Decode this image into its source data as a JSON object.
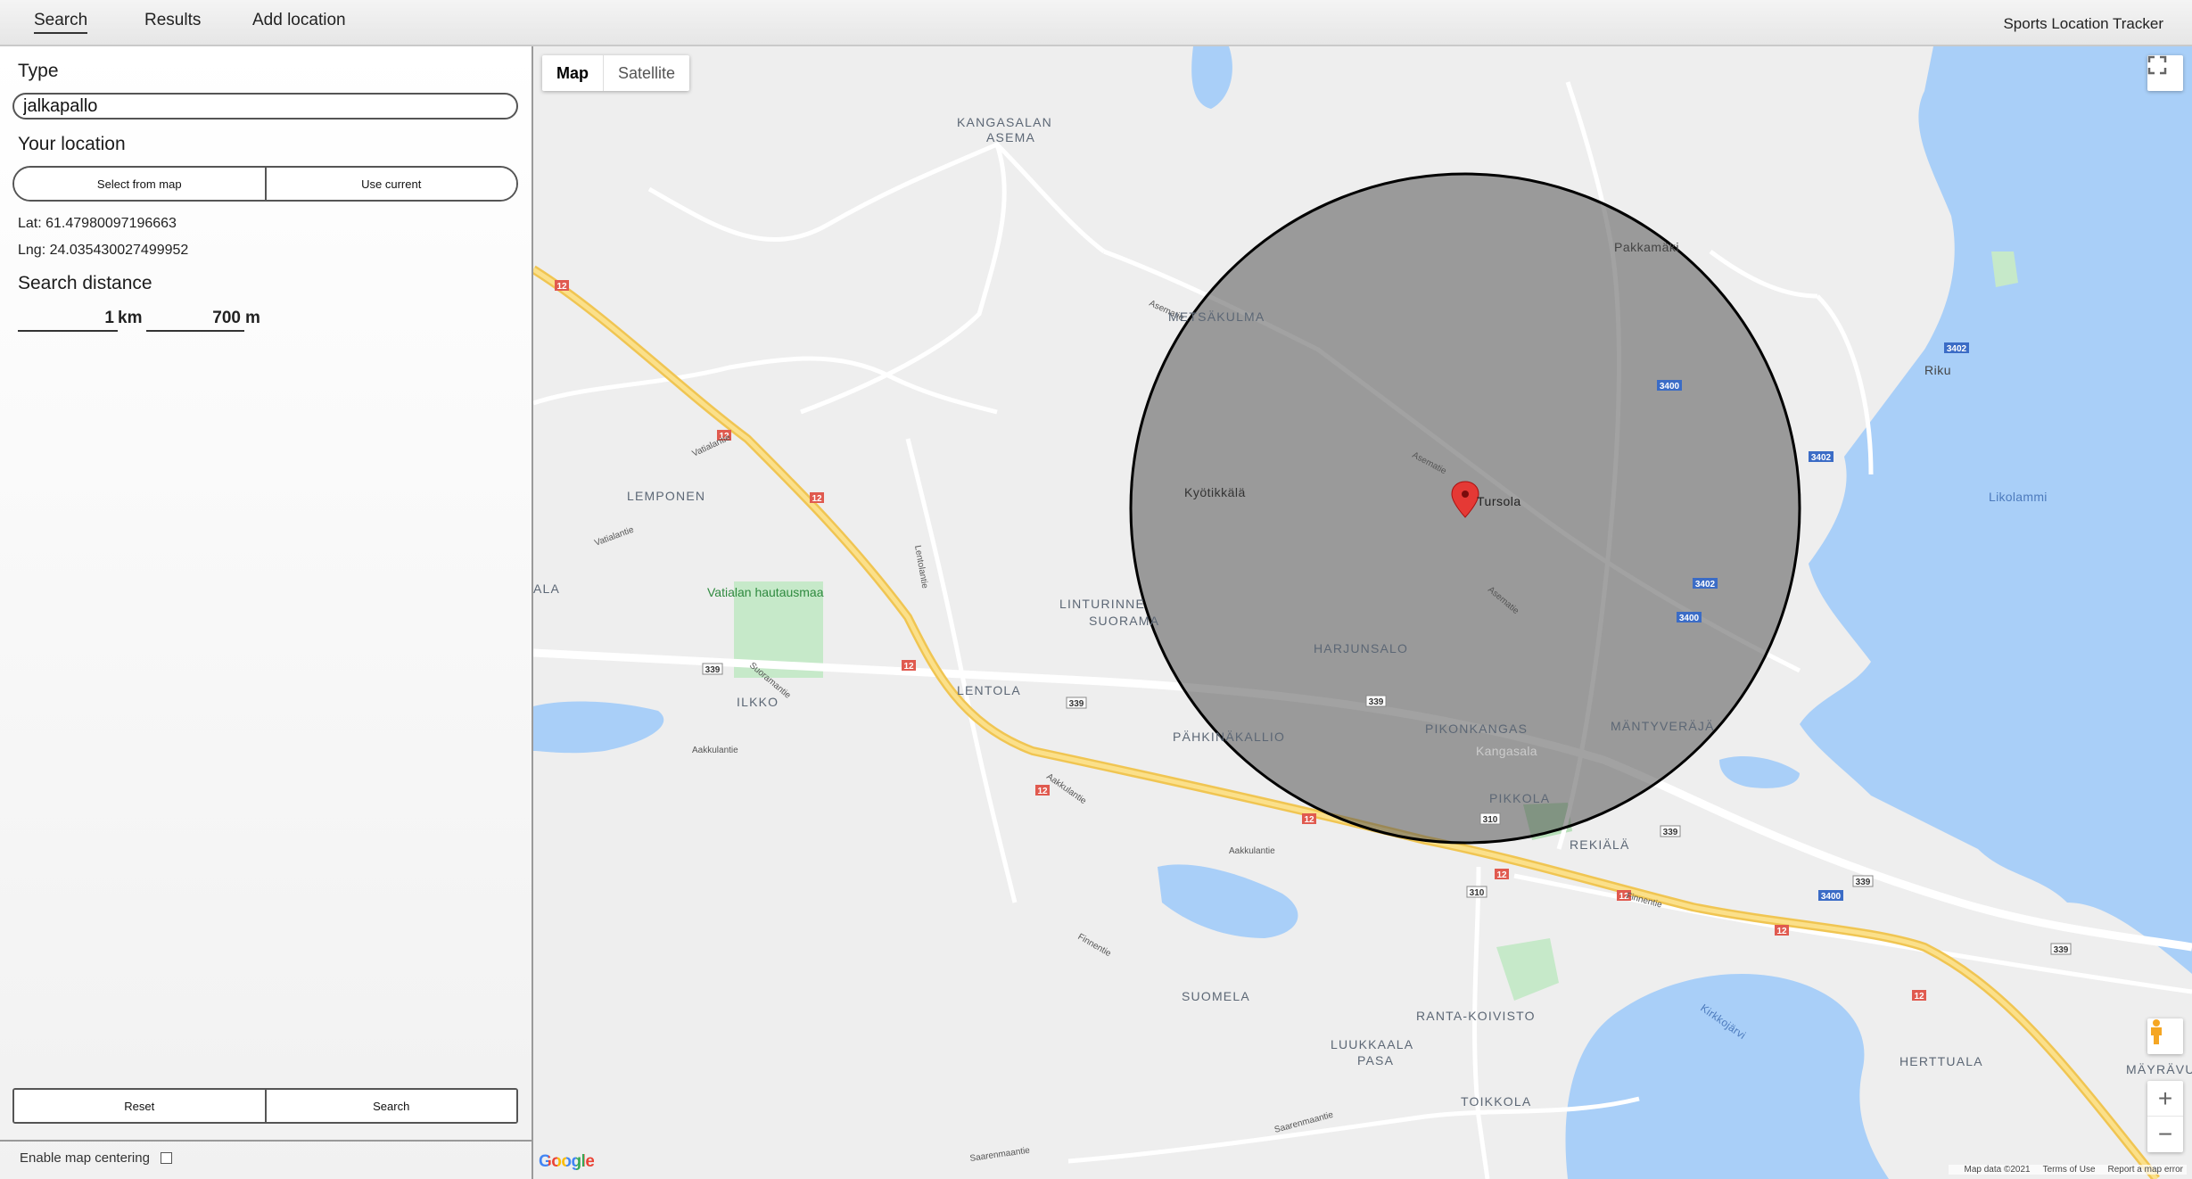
{
  "nav": {
    "tabs": [
      {
        "label": "Search",
        "active": true
      },
      {
        "label": "Results",
        "active": false
      },
      {
        "label": "Add location",
        "active": false
      }
    ],
    "app_title": "Sports Location Tracker"
  },
  "sidebar": {
    "type_heading": "Type",
    "type_value": "jalkapallo",
    "location_heading": "Your location",
    "select_from_map_label": "Select from map",
    "use_current_label": "Use current",
    "lat_text": "Lat: 61.47980097196663",
    "lng_text": "Lng: 24.035430027499952",
    "distance_heading": "Search distance",
    "distance_km": "1",
    "km_unit": "km",
    "distance_m": "700",
    "m_unit": "m",
    "reset_label": "Reset",
    "search_label": "Search",
    "enable_centering_label": "Enable map centering",
    "enable_centering_checked": false
  },
  "map": {
    "type_options": [
      {
        "label": "Map",
        "selected": true
      },
      {
        "label": "Satellite",
        "selected": false
      }
    ],
    "fullscreen_icon": "fullscreen-icon",
    "pegman_icon": "street-view-pegman-icon",
    "zoom_in_label": "+",
    "zoom_out_label": "−",
    "google_logo": "Google",
    "attribution": {
      "map_data": "Map data ©2021",
      "terms": "Terms of Use",
      "report": "Report a map error"
    },
    "marker_icon": "location-pin-icon",
    "colors": {
      "water": "#a9cff8",
      "land": "#eeeeee",
      "park": "#c6e9c9",
      "highway": "#f7d66b",
      "road": "#ffffff",
      "circle_fill": "#555555",
      "marker": "#e53935"
    },
    "labels": {
      "kangasalan_asema": [
        "KANGASALAN",
        "ASEMA"
      ],
      "metsakulma": "METSÄKULMA",
      "pakkamaki": "Pakkamäki",
      "riku": "Riku",
      "likolammi": "Likolammi",
      "lemponen": "LEMPONEN",
      "kyotikkala": "Kyötikkälä",
      "tursola": "Tursola",
      "ala": "ALA",
      "vatiala": "Vatialan hautausmaa",
      "linturinne_suorama": [
        "LINTURINNE",
        "SUORAMA"
      ],
      "harjunsalo": "HARJUNSALO",
      "ilkko": "ILKKO",
      "lentola": "LENTOLA",
      "pahkinakallio": "PÄHKINÄKALLIO",
      "pikonkangas": "PIKONKANGAS",
      "kangasala": "Kangasala",
      "mantyveraja": "MÄNTYVERÄJÄ",
      "pikkola": "PIKKOLA",
      "rekiala": "REKIÄLÄ",
      "suomela": "SUOMELA",
      "ranta_koivisto": "RANTA-KOIVISTO",
      "luukkaala_pasa": [
        "LUUKKAALA",
        "PASA"
      ],
      "toikkola": "TOIKKOLA",
      "herttuala": "HERTTUALA",
      "mayravuori": "MÄYRÄVUORI",
      "kirkkojarvi": "Kirkkojärvi"
    },
    "road_labels": {
      "asematie": "Asematie",
      "vatiala": "Vatialantie",
      "lentola": "Lentolantie",
      "aakkula": "Aakkulantie",
      "finnentie": "Finnentie",
      "saarenmaantie": "Saarenmaantie",
      "suoramantie": "Suoramantie"
    },
    "route_shields": {
      "r12": "12",
      "r339": "339",
      "r310": "310",
      "r3400": "3400",
      "r3402": "3402"
    }
  }
}
